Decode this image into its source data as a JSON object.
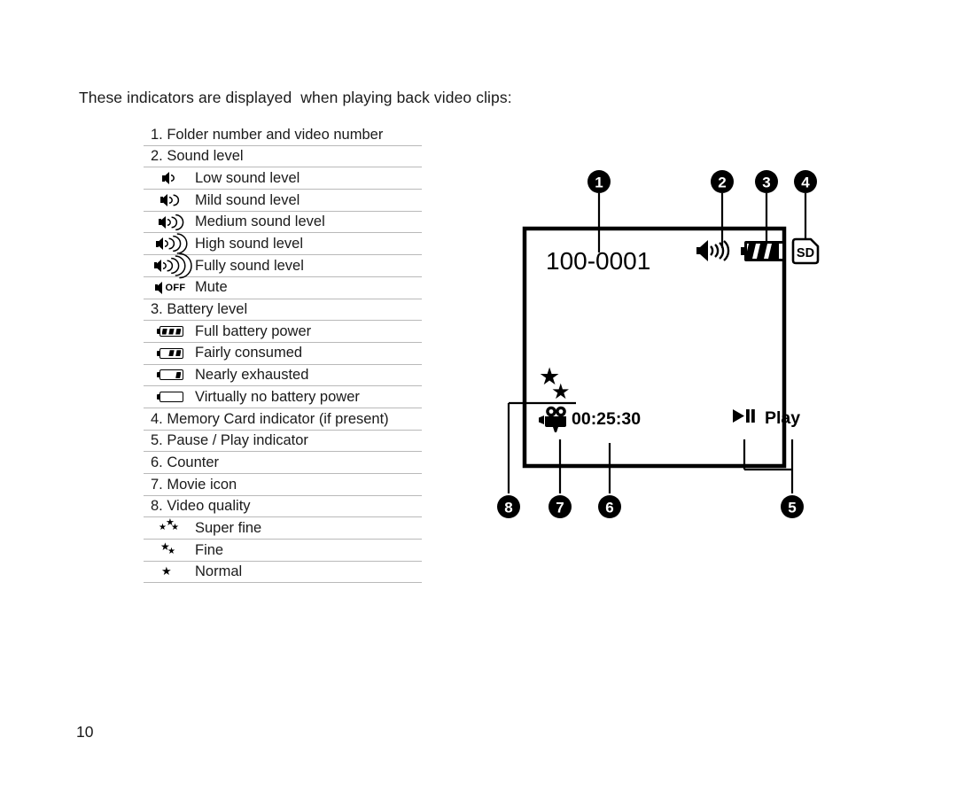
{
  "page": {
    "intro": "These indicators are displayed  when playing back video clips:",
    "number": "10"
  },
  "indicator_table": {
    "rows": [
      {
        "kind": "head",
        "icon": "none",
        "label": "1. Folder number and video number"
      },
      {
        "kind": "head",
        "icon": "none",
        "label": "2. Sound level"
      },
      {
        "kind": "icon",
        "icon": "speaker-level-1",
        "label": "Low sound level"
      },
      {
        "kind": "icon",
        "icon": "speaker-level-2",
        "label": "Mild sound level"
      },
      {
        "kind": "icon",
        "icon": "speaker-level-3",
        "label": "Medium sound level"
      },
      {
        "kind": "icon",
        "icon": "speaker-level-4",
        "label": "High sound level"
      },
      {
        "kind": "icon",
        "icon": "speaker-level-5",
        "label": "Fully sound level"
      },
      {
        "kind": "icon",
        "icon": "speaker-mute",
        "label": "Mute",
        "icon_text": "OFF"
      },
      {
        "kind": "head",
        "icon": "none",
        "label": "3. Battery level"
      },
      {
        "kind": "icon",
        "icon": "battery-full",
        "label": "Full battery power"
      },
      {
        "kind": "icon",
        "icon": "battery-two-thirds",
        "label": "Fairly consumed"
      },
      {
        "kind": "icon",
        "icon": "battery-low",
        "label": "Nearly exhausted"
      },
      {
        "kind": "icon",
        "icon": "battery-empty",
        "label": "Virtually no battery power"
      },
      {
        "kind": "head",
        "icon": "none",
        "label": "4. Memory Card indicator (if present)"
      },
      {
        "kind": "head",
        "icon": "none",
        "label": "5. Pause / Play indicator"
      },
      {
        "kind": "head",
        "icon": "none",
        "label": "6. Counter"
      },
      {
        "kind": "head",
        "icon": "none",
        "label": "7. Movie icon"
      },
      {
        "kind": "head",
        "icon": "none",
        "label": "8. Video quality"
      },
      {
        "kind": "icon",
        "icon": "stars-three",
        "label": "Super fine"
      },
      {
        "kind": "icon",
        "icon": "stars-two",
        "label": "Fine"
      },
      {
        "kind": "icon",
        "icon": "stars-one",
        "label": "Normal"
      }
    ]
  },
  "diagram": {
    "screen": {
      "folder_number": "100-0001",
      "sound_icon": "speaker-level-5",
      "battery_icon": "battery-full",
      "memory_card": "SD",
      "quality_icon": "stars-two",
      "movie_icon": "movie-camera",
      "counter": "00:25:30",
      "playback_icon": "play-pause",
      "playback_label": "Play"
    },
    "callouts": [
      {
        "id": "1",
        "label": "1"
      },
      {
        "id": "2",
        "label": "2"
      },
      {
        "id": "3",
        "label": "3"
      },
      {
        "id": "4",
        "label": "4"
      },
      {
        "id": "5",
        "label": "5"
      },
      {
        "id": "6",
        "label": "6"
      },
      {
        "id": "7",
        "label": "7"
      },
      {
        "id": "8",
        "label": "8"
      }
    ]
  },
  "colors": {
    "ink": "#000000",
    "text": "#1a1a1a",
    "rule": "#b9b9b9",
    "background": "#ffffff"
  }
}
